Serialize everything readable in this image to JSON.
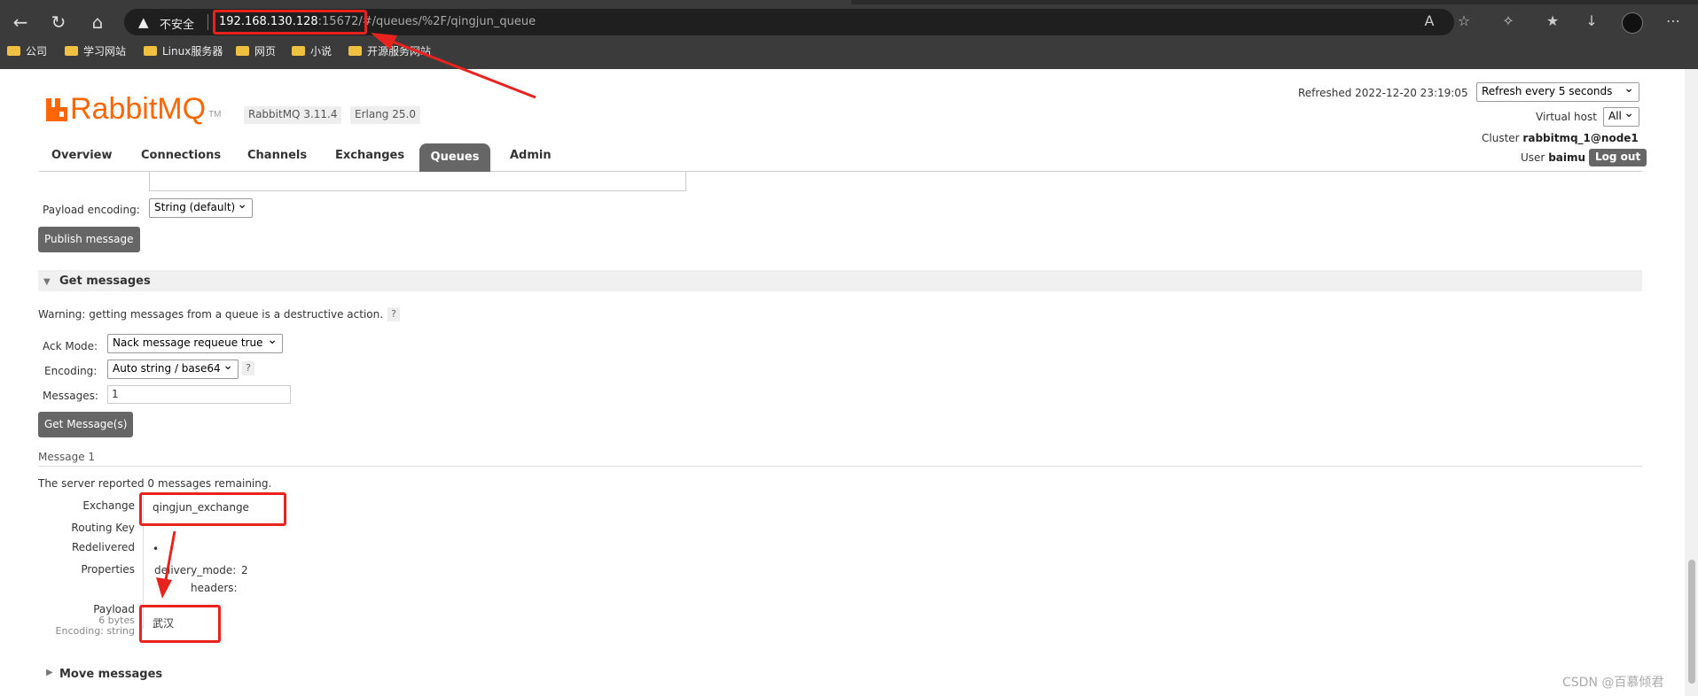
{
  "browser": {
    "insecure_label": "不安全",
    "url_host": "192.168.130.128",
    "url_rest": ":15672/#/queues/%2F/qingjun_queue",
    "bookmarks": [
      "公司",
      "学习网站",
      "Linux服务器",
      "网页",
      "小说",
      "开源服务网站"
    ]
  },
  "header": {
    "logo_text": "RabbitMQ",
    "logo_tm": "TM",
    "version_rabbit": "RabbitMQ 3.11.4",
    "version_erlang": "Erlang 25.0",
    "refreshed_label": "Refreshed 2022-12-20 23:19:05",
    "refresh_select": "Refresh every 5 seconds",
    "vhost_label": "Virtual host",
    "vhost_value": "All",
    "cluster_label": "Cluster",
    "cluster_value": "rabbitmq_1@node1",
    "user_label": "User",
    "user_value": "baimu",
    "logout_label": "Log out"
  },
  "tabs": [
    {
      "label": "Overview"
    },
    {
      "label": "Connections"
    },
    {
      "label": "Channels"
    },
    {
      "label": "Exchanges"
    },
    {
      "label": "Queues"
    },
    {
      "label": "Admin"
    }
  ],
  "publish": {
    "payload_encoding_label": "Payload encoding:",
    "payload_encoding_value": "String (default)",
    "publish_button": "Publish message"
  },
  "get_messages": {
    "title": "Get messages",
    "warning": "Warning: getting messages from a queue is a destructive action.",
    "ack_mode_label": "Ack Mode:",
    "ack_mode_value": "Nack message requeue true",
    "encoding_label": "Encoding:",
    "encoding_value": "Auto string / base64",
    "messages_label": "Messages:",
    "messages_value": "1",
    "get_button": "Get Message(s)",
    "help": "?"
  },
  "message": {
    "title": "Message 1",
    "remaining_prefix": "The server reported",
    "remaining_count": "0",
    "remaining_suffix": "messages remaining.",
    "exchange_label": "Exchange",
    "exchange_value": "qingjun_exchange",
    "routing_key_label": "Routing Key",
    "redelivered_label": "Redelivered",
    "redelivered_value": "•",
    "properties_label": "Properties",
    "delivery_mode_label": "delivery_mode:",
    "delivery_mode_value": "2",
    "headers_label": "headers:",
    "payload_label": "Payload",
    "payload_size": "6 bytes",
    "payload_encoding": "Encoding: string",
    "payload_value": "武汉"
  },
  "move_messages": {
    "title": "Move messages"
  },
  "watermark": "CSDN @百慕倾君",
  "colors": {
    "accent": "#ff6600",
    "annotation": "#e8231d",
    "tab_active": "#666666"
  }
}
